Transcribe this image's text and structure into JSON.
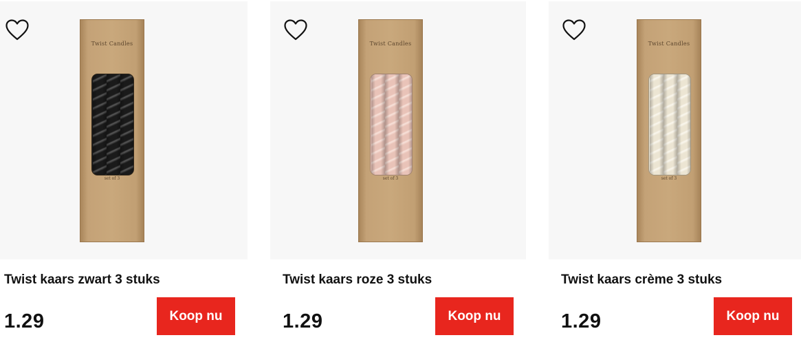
{
  "products": [
    {
      "name": "Twist kaars zwart 3 stuks",
      "price": "1.29",
      "button": "Koop nu",
      "package_title": "Twist Candles",
      "package_subtitle": "set of 3",
      "candle_color": "#1a1a1a",
      "candle_highlight": "#5a5a5a"
    },
    {
      "name": "Twist kaars roze 3 stuks",
      "price": "1.29",
      "button": "Koop nu",
      "package_title": "Twist Candles",
      "package_subtitle": "set of 3",
      "candle_color": "#e9c3b8",
      "candle_highlight": "#f8e2da"
    },
    {
      "name": "Twist kaars crème 3 stuks",
      "price": "1.29",
      "button": "Koop nu",
      "package_title": "Twist Candles",
      "package_subtitle": "set of 3",
      "candle_color": "#ece5d3",
      "candle_highlight": "#faf7ee"
    }
  ],
  "icons": {
    "favorite": "heart-outline-icon"
  },
  "colors": {
    "button_bg": "#e8261e",
    "image_bg": "#f7f7f7",
    "text": "#111111"
  }
}
